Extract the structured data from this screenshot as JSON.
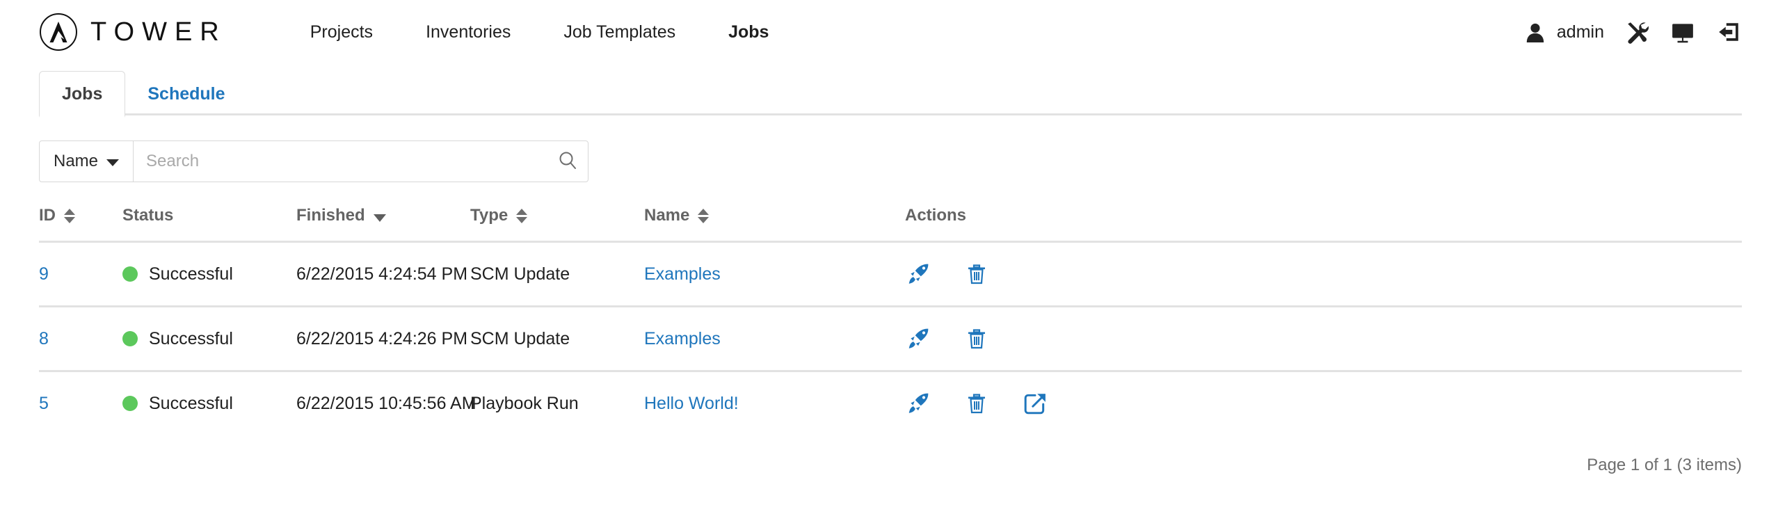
{
  "brand": {
    "logo_icon": "ansible-a-logo-icon",
    "title": "TOWER"
  },
  "mainmenu": {
    "items": [
      {
        "label": "Projects",
        "active": false
      },
      {
        "label": "Inventories",
        "active": false
      },
      {
        "label": "Job Templates",
        "active": false
      },
      {
        "label": "Jobs",
        "active": true
      }
    ]
  },
  "nav_right": {
    "user_icon": "user-icon",
    "username": "admin",
    "icons": [
      {
        "name": "tools-icon"
      },
      {
        "name": "monitor-icon"
      },
      {
        "name": "logout-icon"
      }
    ]
  },
  "tabs": [
    {
      "label": "Jobs",
      "active": true
    },
    {
      "label": "Schedule",
      "active": false
    }
  ],
  "search": {
    "scope_label": "Name",
    "scope_caret_icon": "chevron-down-icon",
    "placeholder": "Search",
    "value": "",
    "submit_icon": "search-icon"
  },
  "table": {
    "columns": [
      {
        "key": "id",
        "label": "ID",
        "sort": "both"
      },
      {
        "key": "status",
        "label": "Status",
        "sort": "none"
      },
      {
        "key": "finished",
        "label": "Finished",
        "sort": "desc"
      },
      {
        "key": "type",
        "label": "Type",
        "sort": "both"
      },
      {
        "key": "name",
        "label": "Name",
        "sort": "both"
      },
      {
        "key": "actions",
        "label": "Actions",
        "sort": "none"
      }
    ],
    "rows": [
      {
        "id": "9",
        "status": "Successful",
        "status_color": "#5cc85c",
        "finished": "6/22/2015 4:24:54 PM",
        "type": "SCM Update",
        "name": "Examples",
        "actions": [
          "relaunch-rocket-icon",
          "delete-trash-icon"
        ]
      },
      {
        "id": "8",
        "status": "Successful",
        "status_color": "#5cc85c",
        "finished": "6/22/2015 4:24:26 PM",
        "type": "SCM Update",
        "name": "Examples",
        "actions": [
          "relaunch-rocket-icon",
          "delete-trash-icon"
        ]
      },
      {
        "id": "5",
        "status": "Successful",
        "status_color": "#5cc85c",
        "finished": "6/22/2015 10:45:56 AM",
        "type": "Playbook Run",
        "name": "Hello World!",
        "actions": [
          "relaunch-rocket-icon",
          "delete-trash-icon",
          "open-external-icon"
        ]
      }
    ]
  },
  "pager": {
    "text": "Page 1 of 1 (3 items)"
  },
  "colors": {
    "link_blue": "#1f76bc",
    "status_green": "#5cc85c",
    "border_gray": "#e2e2e2",
    "header_text": "#646464"
  }
}
